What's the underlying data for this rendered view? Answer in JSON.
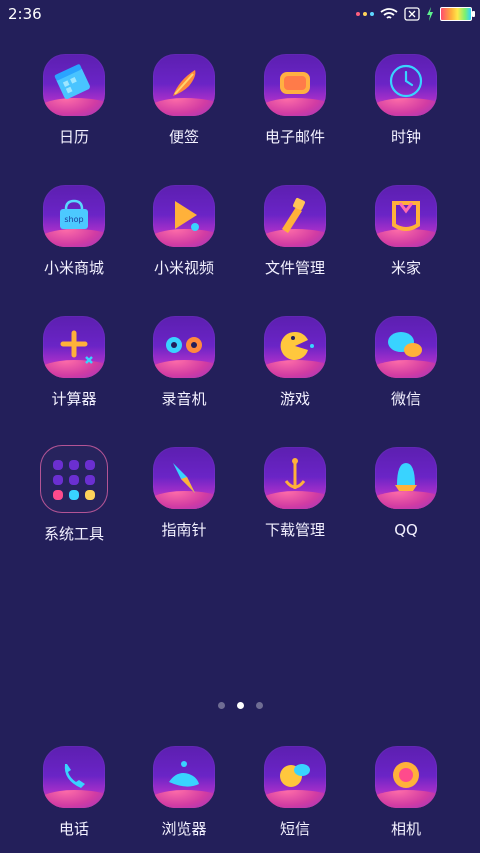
{
  "status_bar": {
    "time": "2:36"
  },
  "apps": [
    {
      "label": "日历",
      "icon": "calendar-icon"
    },
    {
      "label": "便签",
      "icon": "notes-icon"
    },
    {
      "label": "电子邮件",
      "icon": "email-icon"
    },
    {
      "label": "时钟",
      "icon": "clock-icon"
    },
    {
      "label": "小米商城",
      "icon": "shop-icon",
      "badge_text": "shop"
    },
    {
      "label": "小米视频",
      "icon": "video-icon"
    },
    {
      "label": "文件管理",
      "icon": "file-manager-icon"
    },
    {
      "label": "米家",
      "icon": "mijia-icon"
    },
    {
      "label": "计算器",
      "icon": "calculator-icon"
    },
    {
      "label": "录音机",
      "icon": "recorder-icon"
    },
    {
      "label": "游戏",
      "icon": "game-icon"
    },
    {
      "label": "微信",
      "icon": "wechat-icon"
    },
    {
      "label": "系统工具",
      "icon": "folder-icon"
    },
    {
      "label": "指南针",
      "icon": "compass-icon"
    },
    {
      "label": "下载管理",
      "icon": "download-icon"
    },
    {
      "label": "QQ",
      "icon": "qq-icon"
    }
  ],
  "pager": {
    "pages": 3,
    "active": 2
  },
  "dock": [
    {
      "label": "电话",
      "icon": "phone-icon"
    },
    {
      "label": "浏览器",
      "icon": "browser-icon"
    },
    {
      "label": "短信",
      "icon": "messages-icon"
    },
    {
      "label": "相机",
      "icon": "camera-icon"
    }
  ],
  "colors": {
    "background": "#231f5a",
    "icon_top": "#5c1fb0",
    "icon_mid": "#a12ec9",
    "icon_bottom": "#ff4b8c"
  }
}
